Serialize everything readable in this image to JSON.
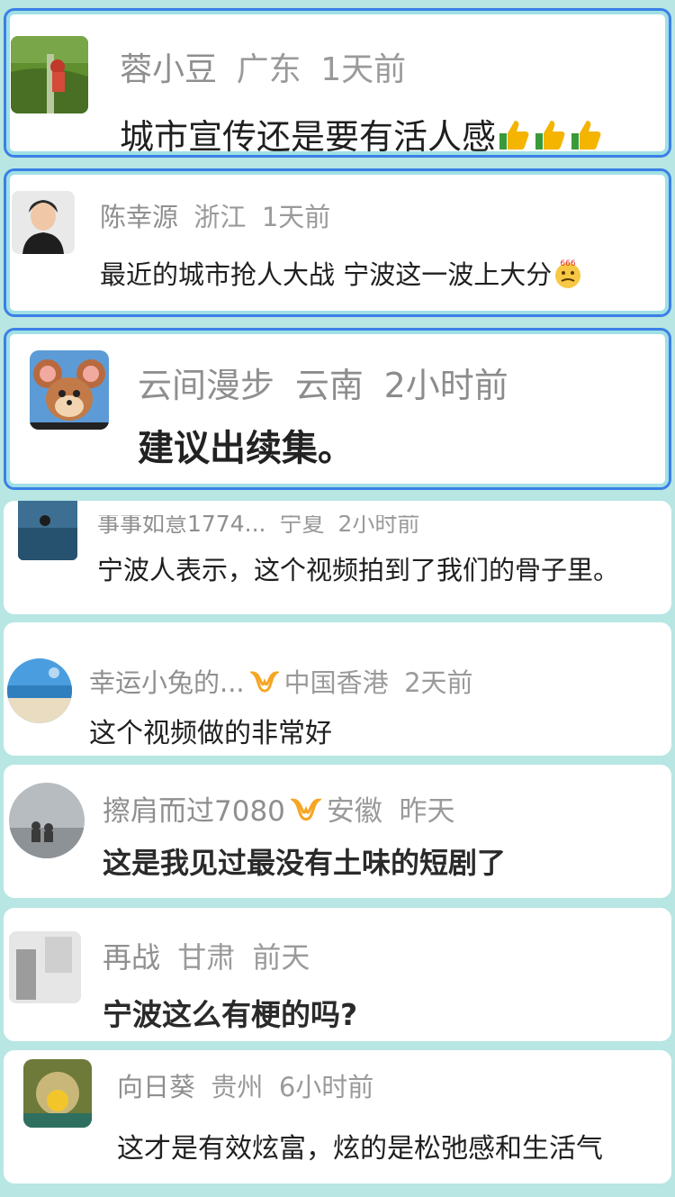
{
  "comments": [
    {
      "name": "蓉小豆",
      "location": "广东",
      "time": "1天前",
      "text": "城市宣传还是要有活人感",
      "emoji": "👍👍👍",
      "emoji_name": "thumbs-up"
    },
    {
      "name": "陈幸源",
      "location": "浙江",
      "time": "1天前",
      "text": "最近的城市抢人大战 宁波这一波上大分",
      "emoji": "666",
      "emoji_name": "thinking-666"
    },
    {
      "name": "云间漫步",
      "location": "云南",
      "time": "2小时前",
      "text": "建议出续集。"
    },
    {
      "name": "事事如意1774...",
      "location": "宁夏",
      "time": "2小时前",
      "text": "宁波人表示，这个视频拍到了我们的骨子里。"
    },
    {
      "name": "幸运小兔的...",
      "location": "中国香港",
      "time": "2天前",
      "text": "这个视频做的非常好",
      "badge": "vip-badge"
    },
    {
      "name": "擦肩而过7080",
      "location": "安徽",
      "time": "昨天",
      "text": "这是我见过最没有土味的短剧了",
      "badge": "vip-badge"
    },
    {
      "name": "再战",
      "location": "甘肃",
      "time": "前天",
      "text": "宁波这么有梗的吗?"
    },
    {
      "name": "向日葵",
      "location": "贵州",
      "time": "6小时前",
      "text": "这才是有效炫富，炫的是松弛感和生活气"
    }
  ],
  "colors": {
    "highlight_border": "#3b7fe6",
    "highlight_glow": "#9fe0e6",
    "background": "#b7e6e3",
    "vip_badge": "#f5a623"
  }
}
